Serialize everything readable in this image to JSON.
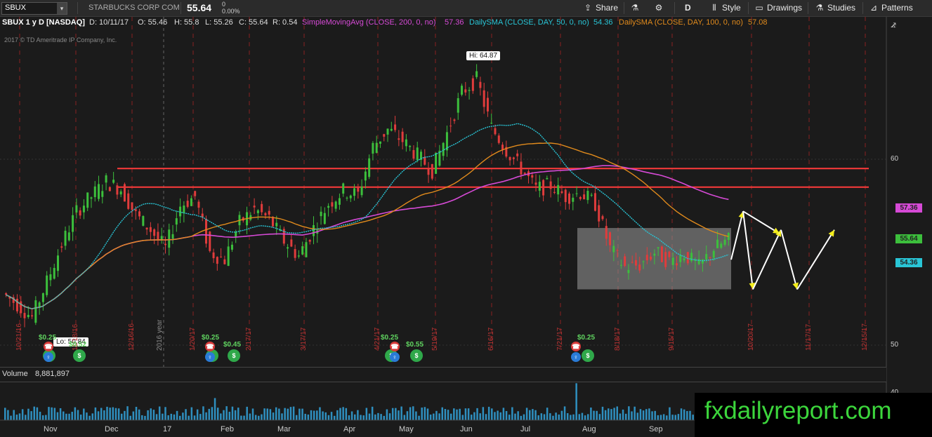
{
  "toolbar": {
    "symbol": "SBUX",
    "company": "STARBUCKS CORP COM",
    "price": "55.64",
    "change_top": "0",
    "change_pct": "0.00%",
    "share_label": "Share",
    "period_label": "D",
    "style_label": "Style",
    "drawings_label": "Drawings",
    "studies_label": "Studies",
    "patterns_label": "Patterns"
  },
  "infobar": {
    "title": "SBUX 1 y D [NASDAQ]",
    "date": "D: 10/11/17",
    "open": "O: 55.46",
    "high": "H: 55.8",
    "low": "L: 55.26",
    "close": "C: 55.64",
    "range": "R: 0.54",
    "sma200_label": "SimpleMovingAvg (CLOSE, 200, 0, no)",
    "sma200_value": "57.36",
    "sma50_label": "DailySMA (CLOSE, DAY, 50, 0, no)",
    "sma50_value": "54.36",
    "sma100_label": "DailySMA (CLOSE, DAY, 100, 0, no)",
    "sma100_value": "57.08"
  },
  "copyright": "2017 © TD Ameritrade IP Company, Inc.",
  "annotations": {
    "high": "Hi: 64.87",
    "low": "Lo: 50.84",
    "year_marker": "2016 year"
  },
  "price_tags": {
    "sma200": "57.36",
    "last": "55.64",
    "sma50": "54.36"
  },
  "y_axis": {
    "tick_60": "60",
    "tick_50": "50",
    "tick_40": "40"
  },
  "volume": {
    "label": "Volume",
    "value": "8,881,897"
  },
  "x_axis": [
    "Nov",
    "Dec",
    "17",
    "Feb",
    "Mar",
    "Apr",
    "May",
    "Jun",
    "Jul",
    "Aug",
    "Sep"
  ],
  "event_dates": [
    "10/21/16",
    "11/18/16",
    "12/16/16",
    "1/20/17",
    "2/17/17",
    "3/17/17",
    "4/21/17",
    "5/19/17",
    "6/16/17",
    "7/21/17",
    "8/18/17",
    "9/15/17",
    "10/20/17",
    "11/17/17",
    "12/15/17"
  ],
  "dividends": [
    "$0.25",
    "$0.52",
    "$0.25",
    "$0.45",
    "$0.25",
    "$0.55",
    "$0.25"
  ],
  "watermark": "fxdailyreport.com",
  "colors": {
    "sma200": "#d64ad6",
    "sma50": "#29c5d6",
    "sma100": "#e08a1c",
    "resistance": "#ff3b3b",
    "up_candle": "#3cbf3c",
    "down_candle": "#e03c3c",
    "box": "#9a9a9a",
    "arrows": "#ffffff",
    "arrowheads": "#f4ee1c",
    "watermark_text": "#3cd63c"
  },
  "chart_data": {
    "type": "candlestick",
    "symbol": "SBUX",
    "ylim": [
      50,
      66
    ],
    "y_ticks": [
      50,
      60
    ],
    "high": 64.87,
    "low": 50.84,
    "last_close": 55.64,
    "sma200_last": 57.36,
    "sma50_last": 54.36,
    "resistance_levels": [
      59.5,
      58.5
    ],
    "range_box": [
      53.0,
      56.3
    ],
    "close_path": [
      52.8,
      52.2,
      51.5,
      53.4,
      55.4,
      57.2,
      58.0,
      58.8,
      58.4,
      57.0,
      56.2,
      55.2,
      57.5,
      58.0,
      55.0,
      54.6,
      56.6,
      57.3,
      56.8,
      55.6,
      54.8,
      56.3,
      57.6,
      58.3,
      58.1,
      60.7,
      61.6,
      61.0,
      60.2,
      59.4,
      61.4,
      63.6,
      64.3,
      61.7,
      60.5,
      59.5,
      58.4,
      58.6,
      58.0,
      58.2,
      57.6,
      55.2,
      54.2,
      54.3,
      55.0,
      54.5,
      54.9,
      54.2,
      55.2,
      55.64
    ]
  }
}
